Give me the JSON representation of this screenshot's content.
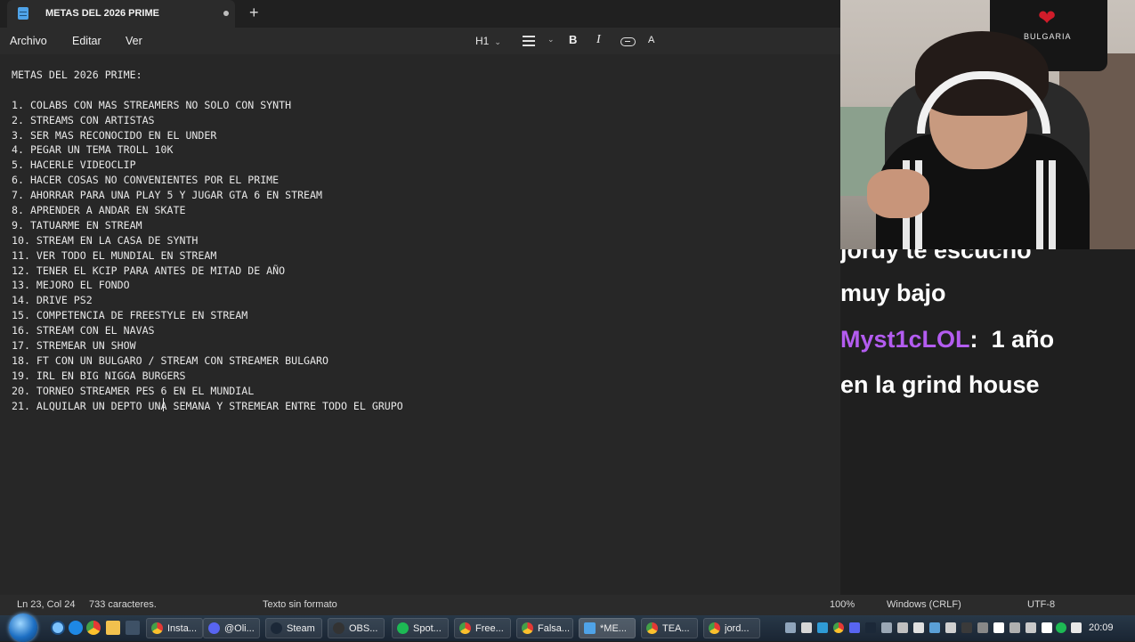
{
  "notepad": {
    "tab_title": "METAS DEL 2026 PRIME",
    "new_tab": "+",
    "menu": [
      "Archivo",
      "Editar",
      "Ver"
    ],
    "toolbar": {
      "heading": "H1",
      "bold": "B",
      "italic": "I",
      "clear_format": "A"
    },
    "document": {
      "lines": [
        "METAS DEL 2026 PRIME:",
        "",
        "1. COLABS CON MAS STREAMERS NO SOLO CON SYNTH",
        "2. STREAMS CON ARTISTAS",
        "3. SER MAS RECONOCIDO EN EL UNDER",
        "4. PEGAR UN TEMA TROLL 10K",
        "5. HACERLE VIDEOCLIP",
        "6. HACER COSAS NO CONVENIENTES POR EL PRIME",
        "7. AHORRAR PARA UNA PLAY 5 Y JUGAR GTA 6 EN STREAM",
        "8. APRENDER A ANDAR EN SKATE",
        "9. TATUARME EN STREAM",
        "10. STREAM EN LA CASA DE SYNTH",
        "11. VER TODO EL MUNDIAL EN STREAM",
        "12. TENER EL KCIP PARA ANTES DE MITAD DE AÑO",
        "13. MEJORO EL FONDO",
        "14. DRIVE PS2",
        "15. COMPETENCIA DE FREESTYLE EN STREAM",
        "16. STREAM CON EL NAVAS",
        "17. STREMEAR UN SHOW",
        "18. FT CON UN BULGARO / STREAM CON STREAMER BULGARO",
        "19. IRL EN BIG NIGGA BURGERS",
        "20. TORNEO STREAMER PES 6 EN EL MUNDIAL",
        "21. ALQUILAR UN DEPTO UNA SEMANA Y STREMEAR ENTRE TODO EL GRUPO"
      ]
    },
    "status": {
      "position": "Ln 23, Col 24",
      "chars": "733 caracteres.",
      "format": "Texto sin formato",
      "zoom": "100%",
      "line_endings": "Windows (CRLF)",
      "encoding": "UTF-8"
    }
  },
  "webcam": {
    "shirt_text": "BULGARIA"
  },
  "chat": {
    "line1": "jordy te escucho",
    "line2": "muy bajo",
    "user": "Myst1cLOL",
    "separator": ":",
    "message_part1": "1 año",
    "message_part2": "en la grind house"
  },
  "taskbar": {
    "items": [
      "Insta...",
      "@Oli...",
      "Steam",
      "OBS...",
      "Spot...",
      "Free...",
      "Falsa...",
      "*ME...",
      "TEA...",
      "jord..."
    ],
    "clock": "20:09"
  },
  "colors": {
    "chat_username": "#b35cf0",
    "editor_bg": "#272727",
    "accent": "#4fa3e8"
  }
}
